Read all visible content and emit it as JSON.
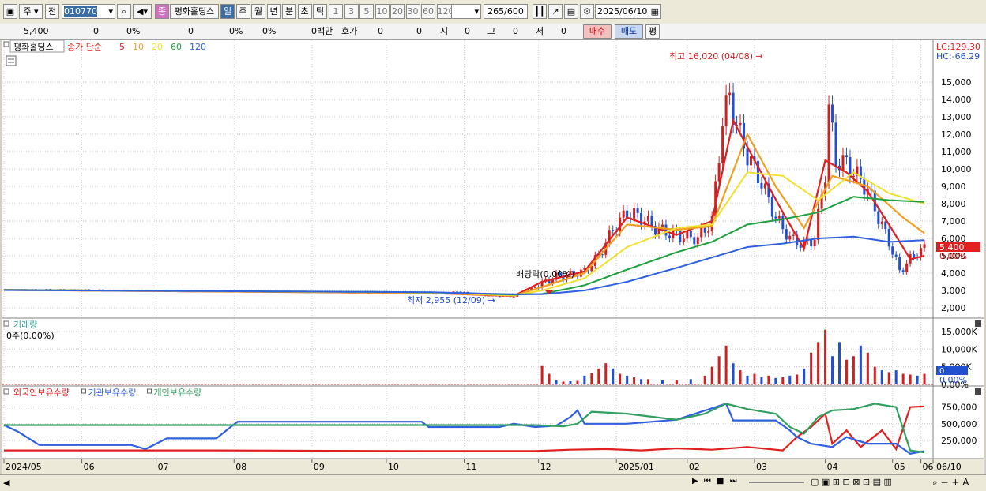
{
  "toolbar": {
    "market_label": "주",
    "prev_label": "전",
    "code_value": "010770",
    "stock_name": "평화홀딩스",
    "stock_badge": "종",
    "period_tabs": [
      "일",
      "주",
      "월",
      "년",
      "분",
      "초",
      "틱"
    ],
    "active_period": "일",
    "interval_buttons": [
      "1",
      "3",
      "5",
      "10",
      "20",
      "30",
      "60",
      "120"
    ],
    "count_value": "265",
    "count_total": "/600",
    "date_value": "2025/06/10"
  },
  "quote": {
    "price": "5,400",
    "change": "0",
    "change_pct": "0%",
    "volume": "0",
    "vol_pct": "0%",
    "vol_pct2": "0%",
    "amount": "0백만",
    "hoga_label": "호가",
    "hoga1": "0",
    "hoga2": "0",
    "open_label": "시",
    "open": "0",
    "high_label": "고",
    "high": "0",
    "low_label": "저",
    "low": "0",
    "buy_label": "매수",
    "sell_label": "매도",
    "flat_label": "평"
  },
  "legend": {
    "main": {
      "stock": "평화홀딩스",
      "price_label": "종가 단순",
      "mas": [
        {
          "period": "5",
          "color": "#e02020"
        },
        {
          "period": "10",
          "color": "#f0a020"
        },
        {
          "period": "20",
          "color": "#f0e030"
        },
        {
          "period": "60",
          "color": "#20a040"
        },
        {
          "period": "120",
          "color": "#3060e0"
        }
      ]
    },
    "volume": {
      "title": "거래량",
      "value": "0주(0.00%)"
    },
    "holdings": [
      {
        "name": "외국인보유수량",
        "color": "#e02020"
      },
      {
        "name": "기관보유수량",
        "color": "#3060e0"
      },
      {
        "name": "개인보유수량",
        "color": "#30a060"
      }
    ]
  },
  "annotations": {
    "lc": "LC:129.30",
    "hc": "HC:-66.29",
    "high_note": "최고 16,020 (04/08) →",
    "low_note": "최저 2,955 (12/09) →",
    "dividend_note": "배당락(0.00%)",
    "current_price_tag": "5,400",
    "current_pct_tag": "0.00%",
    "volume_tag": "0",
    "volume_pct_tag": "0.00%"
  },
  "colors": {
    "up": "#d02020",
    "down": "#2050d0",
    "accent": "#3a6ea5"
  },
  "chart_data": [
    {
      "type": "candlestick",
      "title": "",
      "yaxis_ticks": [
        "15,000",
        "14,000",
        "13,000",
        "12,000",
        "11,000",
        "10,000",
        "9,000",
        "8,000",
        "7,000",
        "6,000",
        "5,000",
        "4,000",
        "3,000",
        "2,000"
      ],
      "ylim": [
        1500,
        16500
      ],
      "x_ticks": [
        "2024/05",
        "06",
        "07",
        "08",
        "09",
        "10",
        "11",
        "12",
        "2025/01",
        "02",
        "03",
        "04",
        "05",
        "06",
        "06/10"
      ],
      "price_path": [
        [
          0,
          3050
        ],
        [
          15,
          3050
        ],
        [
          30,
          3020
        ],
        [
          44,
          3000
        ],
        [
          58,
          2990
        ],
        [
          72,
          2960
        ],
        [
          86,
          2920
        ],
        [
          100,
          2880
        ],
        [
          112,
          2860
        ],
        [
          124,
          2800
        ],
        [
          128,
          2955
        ],
        [
          136,
          2700
        ],
        [
          144,
          2650
        ],
        [
          152,
          3400
        ],
        [
          156,
          3800
        ],
        [
          160,
          3900
        ],
        [
          164,
          4100
        ],
        [
          168,
          5000
        ],
        [
          172,
          6500
        ],
        [
          176,
          7500
        ],
        [
          180,
          7200
        ],
        [
          184,
          6600
        ],
        [
          188,
          6300
        ],
        [
          192,
          6100
        ],
        [
          196,
          6000
        ],
        [
          200,
          7000
        ],
        [
          203,
          12800
        ],
        [
          205,
          14200
        ],
        [
          207,
          12500
        ],
        [
          210,
          10800
        ],
        [
          214,
          9200
        ],
        [
          218,
          7200
        ],
        [
          222,
          6000
        ],
        [
          226,
          5600
        ],
        [
          229,
          6000
        ],
        [
          232,
          9800
        ],
        [
          233,
          13500
        ],
        [
          235,
          10500
        ],
        [
          238,
          10300
        ],
        [
          241,
          9600
        ],
        [
          244,
          8800
        ],
        [
          247,
          7200
        ],
        [
          250,
          5800
        ],
        [
          253,
          4100
        ],
        [
          256,
          4800
        ],
        [
          258,
          5200
        ],
        [
          260,
          5400
        ]
      ],
      "ma_series": [
        {
          "period": "5",
          "points": [
            [
              0,
              3030
            ],
            [
              120,
              2850
            ],
            [
              144,
              2680
            ],
            [
              152,
              3500
            ],
            [
              164,
              4100
            ],
            [
              176,
              7200
            ],
            [
              190,
              6200
            ],
            [
              200,
              7000
            ],
            [
              206,
              12800
            ],
            [
              212,
              10500
            ],
            [
              220,
              7500
            ],
            [
              226,
              5400
            ],
            [
              232,
              10500
            ],
            [
              238,
              9800
            ],
            [
              244,
              8700
            ],
            [
              250,
              6800
            ],
            [
              256,
              4800
            ],
            [
              260,
              5000
            ]
          ]
        },
        {
          "period": "10",
          "points": [
            [
              0,
              3030
            ],
            [
              120,
              2860
            ],
            [
              144,
              2700
            ],
            [
              152,
              3200
            ],
            [
              164,
              4000
            ],
            [
              176,
              6800
            ],
            [
              190,
              6500
            ],
            [
              200,
              6700
            ],
            [
              210,
              12000
            ],
            [
              218,
              9000
            ],
            [
              226,
              6600
            ],
            [
              234,
              9600
            ],
            [
              244,
              9000
            ],
            [
              254,
              7200
            ],
            [
              260,
              6300
            ]
          ]
        },
        {
          "period": "20",
          "points": [
            [
              0,
              3030
            ],
            [
              120,
              2880
            ],
            [
              144,
              2720
            ],
            [
              152,
              3000
            ],
            [
              164,
              3700
            ],
            [
              176,
              5500
            ],
            [
              190,
              6600
            ],
            [
              200,
              6800
            ],
            [
              210,
              9800
            ],
            [
              220,
              9600
            ],
            [
              230,
              8200
            ],
            [
              240,
              9800
            ],
            [
              250,
              8600
            ],
            [
              260,
              8000
            ]
          ]
        },
        {
          "period": "60",
          "points": [
            [
              0,
              3030
            ],
            [
              120,
              2900
            ],
            [
              144,
              2760
            ],
            [
              152,
              2800
            ],
            [
              164,
              3300
            ],
            [
              176,
              4200
            ],
            [
              190,
              5200
            ],
            [
              200,
              5800
            ],
            [
              210,
              6800
            ],
            [
              220,
              7100
            ],
            [
              230,
              7500
            ],
            [
              240,
              8400
            ],
            [
              250,
              8200
            ],
            [
              260,
              8100
            ]
          ]
        },
        {
          "period": "120",
          "points": [
            [
              0,
              3020
            ],
            [
              120,
              2900
            ],
            [
              144,
              2780
            ],
            [
              152,
              2780
            ],
            [
              164,
              3000
            ],
            [
              176,
              3500
            ],
            [
              190,
              4300
            ],
            [
              200,
              4900
            ],
            [
              210,
              5500
            ],
            [
              220,
              5700
            ],
            [
              230,
              6000
            ],
            [
              240,
              6100
            ],
            [
              250,
              5800
            ],
            [
              260,
              5900
            ]
          ]
        }
      ]
    },
    {
      "type": "bar",
      "title": "",
      "ylim": [
        0,
        17000
      ],
      "yaxis_ticks": [
        "15,000K",
        "10,000K",
        "5,000K",
        "0.00%"
      ],
      "bars": [
        [
          152,
          5200,
          "up"
        ],
        [
          154,
          3000,
          "up"
        ],
        [
          156,
          1200,
          "down"
        ],
        [
          158,
          800,
          "up"
        ],
        [
          160,
          900,
          "down"
        ],
        [
          162,
          1000,
          "up"
        ],
        [
          164,
          2500,
          "down"
        ],
        [
          166,
          3200,
          "up"
        ],
        [
          168,
          4500,
          "up"
        ],
        [
          170,
          6000,
          "up"
        ],
        [
          172,
          4500,
          "down"
        ],
        [
          174,
          3000,
          "up"
        ],
        [
          176,
          2500,
          "down"
        ],
        [
          178,
          2000,
          "up"
        ],
        [
          180,
          1500,
          "down"
        ],
        [
          182,
          1500,
          "up"
        ],
        [
          186,
          1200,
          "down"
        ],
        [
          190,
          1200,
          "up"
        ],
        [
          194,
          1500,
          "down"
        ],
        [
          198,
          2500,
          "up"
        ],
        [
          200,
          5000,
          "up"
        ],
        [
          202,
          8000,
          "up"
        ],
        [
          204,
          11000,
          "up"
        ],
        [
          206,
          6000,
          "down"
        ],
        [
          208,
          4000,
          "up"
        ],
        [
          210,
          2500,
          "down"
        ],
        [
          212,
          3000,
          "up"
        ],
        [
          214,
          2000,
          "down"
        ],
        [
          216,
          2500,
          "up"
        ],
        [
          218,
          1800,
          "down"
        ],
        [
          220,
          2000,
          "up"
        ],
        [
          222,
          2500,
          "down"
        ],
        [
          224,
          2800,
          "up"
        ],
        [
          226,
          4500,
          "down"
        ],
        [
          228,
          9000,
          "up"
        ],
        [
          230,
          12000,
          "up"
        ],
        [
          232,
          15500,
          "up"
        ],
        [
          234,
          8000,
          "down"
        ],
        [
          236,
          12000,
          "down"
        ],
        [
          238,
          7000,
          "up"
        ],
        [
          240,
          8000,
          "up"
        ],
        [
          242,
          11000,
          "down"
        ],
        [
          244,
          9000,
          "up"
        ],
        [
          246,
          5000,
          "up"
        ],
        [
          248,
          4000,
          "down"
        ],
        [
          250,
          3500,
          "up"
        ],
        [
          252,
          4000,
          "down"
        ],
        [
          254,
          3000,
          "up"
        ],
        [
          256,
          2800,
          "up"
        ],
        [
          258,
          2500,
          "down"
        ],
        [
          260,
          3000,
          "up"
        ]
      ]
    },
    {
      "type": "line",
      "title": "",
      "ylim": [
        0,
        900000
      ],
      "yaxis_ticks": [
        "750,000",
        "500,000",
        "250,000"
      ],
      "series": [
        {
          "name": "외국인보유수량",
          "points": [
            [
              0,
              100000
            ],
            [
              60,
              100000
            ],
            [
              120,
              90000
            ],
            [
              150,
              90000
            ],
            [
              160,
              110000
            ],
            [
              170,
              120000
            ],
            [
              180,
              100000
            ],
            [
              190,
              130000
            ],
            [
              200,
              110000
            ],
            [
              210,
              150000
            ],
            [
              220,
              100000
            ],
            [
              224,
              300000
            ],
            [
              228,
              450000
            ],
            [
              232,
              650000
            ],
            [
              234,
              200000
            ],
            [
              238,
              400000
            ],
            [
              242,
              150000
            ],
            [
              248,
              400000
            ],
            [
              252,
              120000
            ],
            [
              256,
              750000
            ],
            [
              260,
              760000
            ]
          ]
        },
        {
          "name": "기관보유수량",
          "points": [
            [
              0,
              480000
            ],
            [
              4,
              380000
            ],
            [
              10,
              180000
            ],
            [
              36,
              180000
            ],
            [
              40,
              120000
            ],
            [
              46,
              280000
            ],
            [
              60,
              280000
            ],
            [
              64,
              450000
            ],
            [
              66,
              530000
            ],
            [
              118,
              530000
            ],
            [
              120,
              450000
            ],
            [
              140,
              450000
            ],
            [
              144,
              500000
            ],
            [
              150,
              450000
            ],
            [
              156,
              470000
            ],
            [
              160,
              600000
            ],
            [
              162,
              700000
            ],
            [
              164,
              500000
            ],
            [
              176,
              500000
            ],
            [
              190,
              560000
            ],
            [
              204,
              800000
            ],
            [
              206,
              550000
            ],
            [
              218,
              550000
            ],
            [
              222,
              400000
            ],
            [
              224,
              300000
            ],
            [
              228,
              200000
            ],
            [
              234,
              150000
            ],
            [
              238,
              300000
            ],
            [
              244,
              200000
            ],
            [
              252,
              200000
            ],
            [
              256,
              50000
            ],
            [
              260,
              90000
            ]
          ]
        },
        {
          "name": "개인보유수량",
          "points": [
            [
              0,
              480000
            ],
            [
              60,
              480000
            ],
            [
              120,
              480000
            ],
            [
              150,
              480000
            ],
            [
              158,
              460000
            ],
            [
              162,
              500000
            ],
            [
              166,
              680000
            ],
            [
              176,
              650000
            ],
            [
              190,
              560000
            ],
            [
              198,
              650000
            ],
            [
              204,
              800000
            ],
            [
              210,
              720000
            ],
            [
              218,
              650000
            ],
            [
              222,
              450000
            ],
            [
              226,
              350000
            ],
            [
              230,
              600000
            ],
            [
              234,
              700000
            ],
            [
              240,
              720000
            ],
            [
              246,
              800000
            ],
            [
              252,
              750000
            ],
            [
              256,
              100000
            ],
            [
              260,
              70000
            ]
          ]
        }
      ]
    }
  ]
}
